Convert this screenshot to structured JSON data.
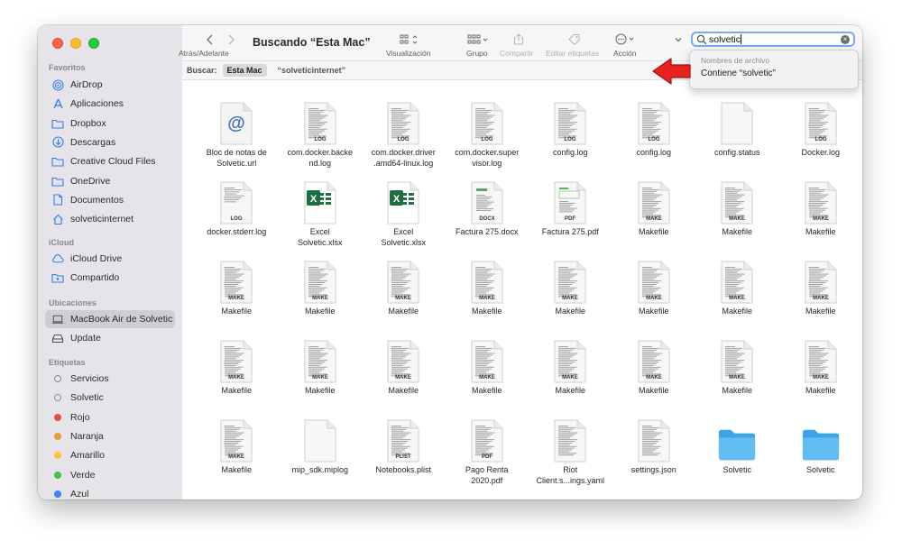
{
  "toolbar": {
    "title": "Buscando “Esta Mac”",
    "nav_label": "Atrás/Adelante",
    "view_label": "Visualización",
    "group_label": "Grupo",
    "share_label": "Compartir",
    "tags_label": "Editar etiquetas",
    "action_label": "Acción",
    "search_value": "solvetic"
  },
  "scope": {
    "label": "Buscar:",
    "selected": "Esta Mac",
    "other": "“solveticinternet”"
  },
  "suggestions": {
    "header": "Nombres de archivo",
    "item": "Contiene “solvetic”"
  },
  "sidebar": {
    "favorites_header": "Favoritos",
    "favorites": [
      {
        "label": "AirDrop",
        "icon": "airdrop-icon"
      },
      {
        "label": "Aplicaciones",
        "icon": "applications-icon"
      },
      {
        "label": "Dropbox",
        "icon": "folder-icon"
      },
      {
        "label": "Descargas",
        "icon": "downloads-icon"
      },
      {
        "label": "Creative Cloud Files",
        "icon": "folder-icon"
      },
      {
        "label": "OneDrive",
        "icon": "folder-icon"
      },
      {
        "label": "Documentos",
        "icon": "document-icon"
      },
      {
        "label": "solveticinternet",
        "icon": "home-icon"
      }
    ],
    "icloud_header": "iCloud",
    "icloud": [
      {
        "label": "iCloud Drive",
        "icon": "cloud-icon"
      },
      {
        "label": "Compartido",
        "icon": "shared-folder-icon"
      }
    ],
    "locations_header": "Ubicaciones",
    "locations": [
      {
        "label": "MacBook Air de Solvetic",
        "icon": "laptop-icon"
      },
      {
        "label": "Update",
        "icon": "drive-icon"
      }
    ],
    "tags_header": "Etiquetas",
    "tags": [
      {
        "label": "Servicios",
        "color": "none"
      },
      {
        "label": "Solvetic",
        "color": "none"
      },
      {
        "label": "Rojo",
        "color": "#ec4a40"
      },
      {
        "label": "Naranja",
        "color": "#f19a38"
      },
      {
        "label": "Amarillo",
        "color": "#f5c632"
      },
      {
        "label": "Verde",
        "color": "#4cbf48"
      },
      {
        "label": "Azul",
        "color": "#3b82f4"
      }
    ]
  },
  "files": [
    {
      "name": "Bloc de notas de\nSolvetic.url",
      "type": "url"
    },
    {
      "name": "com.docker.backe\nnd.log",
      "type": "log"
    },
    {
      "name": "com.docker.driver\n.amd64-linux.log",
      "type": "log"
    },
    {
      "name": "com.docker.super\nvisor.log",
      "type": "log"
    },
    {
      "name": "config.log",
      "type": "log"
    },
    {
      "name": "config.log",
      "type": "log"
    },
    {
      "name": "config.status",
      "type": "blank"
    },
    {
      "name": "Docker.log",
      "type": "log"
    },
    {
      "name": "docker.stderr.log",
      "type": "log-plain"
    },
    {
      "name": "Excel\nSolvetic.xlsx",
      "type": "excel"
    },
    {
      "name": "Excel\nSolvetic.xlsx",
      "type": "excel"
    },
    {
      "name": "Factura 275.docx",
      "type": "docx"
    },
    {
      "name": "Factura 275.pdf",
      "type": "pdf-green"
    },
    {
      "name": "Makefile",
      "type": "make"
    },
    {
      "name": "Makefile",
      "type": "make"
    },
    {
      "name": "Makefile",
      "type": "make"
    },
    {
      "name": "Makefile",
      "type": "make"
    },
    {
      "name": "Makefile",
      "type": "make"
    },
    {
      "name": "Makefile",
      "type": "make"
    },
    {
      "name": "Makefile",
      "type": "make"
    },
    {
      "name": "Makefile",
      "type": "make"
    },
    {
      "name": "Makefile",
      "type": "make"
    },
    {
      "name": "Makefile",
      "type": "make"
    },
    {
      "name": "Makefile",
      "type": "make"
    },
    {
      "name": "Makefile",
      "type": "make"
    },
    {
      "name": "Makefile",
      "type": "make"
    },
    {
      "name": "Makefile",
      "type": "make"
    },
    {
      "name": "Makefile",
      "type": "make"
    },
    {
      "name": "Makefile",
      "type": "make"
    },
    {
      "name": "Makefile",
      "type": "make"
    },
    {
      "name": "Makefile",
      "type": "make"
    },
    {
      "name": "Makefile",
      "type": "make"
    },
    {
      "name": "Makefile",
      "type": "make"
    },
    {
      "name": "mip_sdk.miplog",
      "type": "blank"
    },
    {
      "name": "Notebooks.plist",
      "type": "plist"
    },
    {
      "name": "Pago Renta\n2020.pdf",
      "type": "pdf"
    },
    {
      "name": "Riot\nClient.s...ings.yaml",
      "type": "text"
    },
    {
      "name": "settings.json",
      "type": "text"
    },
    {
      "name": "Solvetic",
      "type": "folder"
    },
    {
      "name": "Solvetic",
      "type": "folder"
    }
  ]
}
